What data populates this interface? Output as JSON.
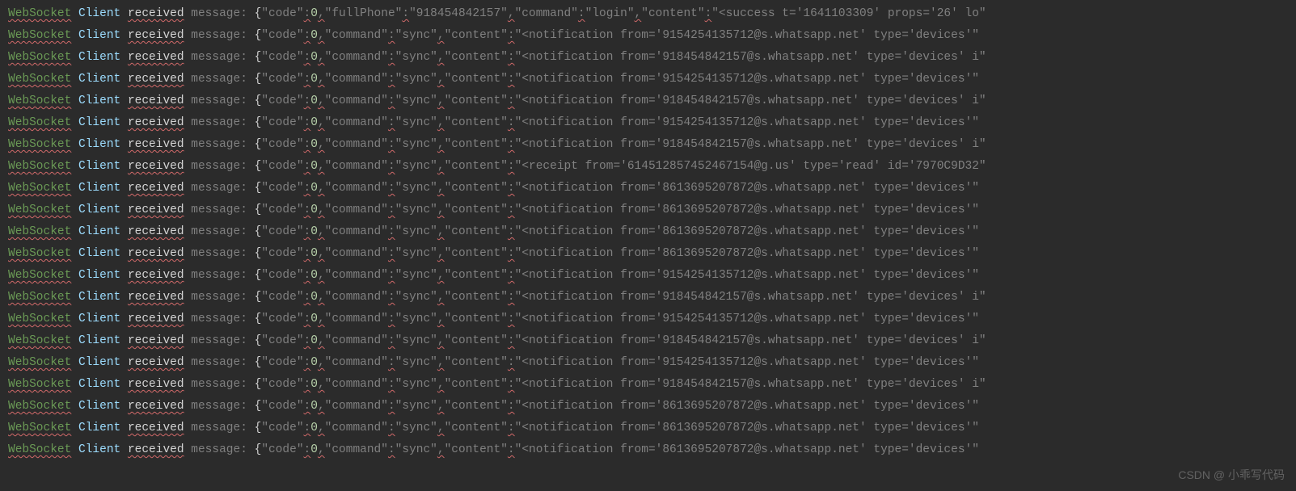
{
  "prefix": {
    "websocket": "WebSocket",
    "client": "Client",
    "received": "received",
    "message_label": "message:"
  },
  "watermark": "CSDN @ 小乖写代码",
  "lines": [
    {
      "code": 0,
      "fullPhone": "918454842157",
      "command": "login",
      "content": "<success t='1641103309' props='26' lo"
    },
    {
      "code": 0,
      "command": "sync",
      "content": "<notification from='9154254135712@s.whatsapp.net' type='devices'"
    },
    {
      "code": 0,
      "command": "sync",
      "content": "<notification from='918454842157@s.whatsapp.net' type='devices' i"
    },
    {
      "code": 0,
      "command": "sync",
      "content": "<notification from='9154254135712@s.whatsapp.net' type='devices'"
    },
    {
      "code": 0,
      "command": "sync",
      "content": "<notification from='918454842157@s.whatsapp.net' type='devices' i"
    },
    {
      "code": 0,
      "command": "sync",
      "content": "<notification from='9154254135712@s.whatsapp.net' type='devices'"
    },
    {
      "code": 0,
      "command": "sync",
      "content": "<notification from='918454842157@s.whatsapp.net' type='devices' i"
    },
    {
      "code": 0,
      "command": "sync",
      "content": "<receipt from='614512857452467154@g.us' type='read' id='7970C9D32"
    },
    {
      "code": 0,
      "command": "sync",
      "content": "<notification from='8613695207872@s.whatsapp.net' type='devices'"
    },
    {
      "code": 0,
      "command": "sync",
      "content": "<notification from='8613695207872@s.whatsapp.net' type='devices'"
    },
    {
      "code": 0,
      "command": "sync",
      "content": "<notification from='8613695207872@s.whatsapp.net' type='devices'"
    },
    {
      "code": 0,
      "command": "sync",
      "content": "<notification from='8613695207872@s.whatsapp.net' type='devices'"
    },
    {
      "code": 0,
      "command": "sync",
      "content": "<notification from='9154254135712@s.whatsapp.net' type='devices'"
    },
    {
      "code": 0,
      "command": "sync",
      "content": "<notification from='918454842157@s.whatsapp.net' type='devices' i"
    },
    {
      "code": 0,
      "command": "sync",
      "content": "<notification from='9154254135712@s.whatsapp.net' type='devices'"
    },
    {
      "code": 0,
      "command": "sync",
      "content": "<notification from='918454842157@s.whatsapp.net' type='devices' i"
    },
    {
      "code": 0,
      "command": "sync",
      "content": "<notification from='9154254135712@s.whatsapp.net' type='devices'"
    },
    {
      "code": 0,
      "command": "sync",
      "content": "<notification from='918454842157@s.whatsapp.net' type='devices' i"
    },
    {
      "code": 0,
      "command": "sync",
      "content": "<notification from='8613695207872@s.whatsapp.net' type='devices'"
    },
    {
      "code": 0,
      "command": "sync",
      "content": "<notification from='8613695207872@s.whatsapp.net' type='devices'"
    },
    {
      "code": 0,
      "command": "sync",
      "content": "<notification from='8613695207872@s.whatsapp.net' type='devices'"
    }
  ]
}
